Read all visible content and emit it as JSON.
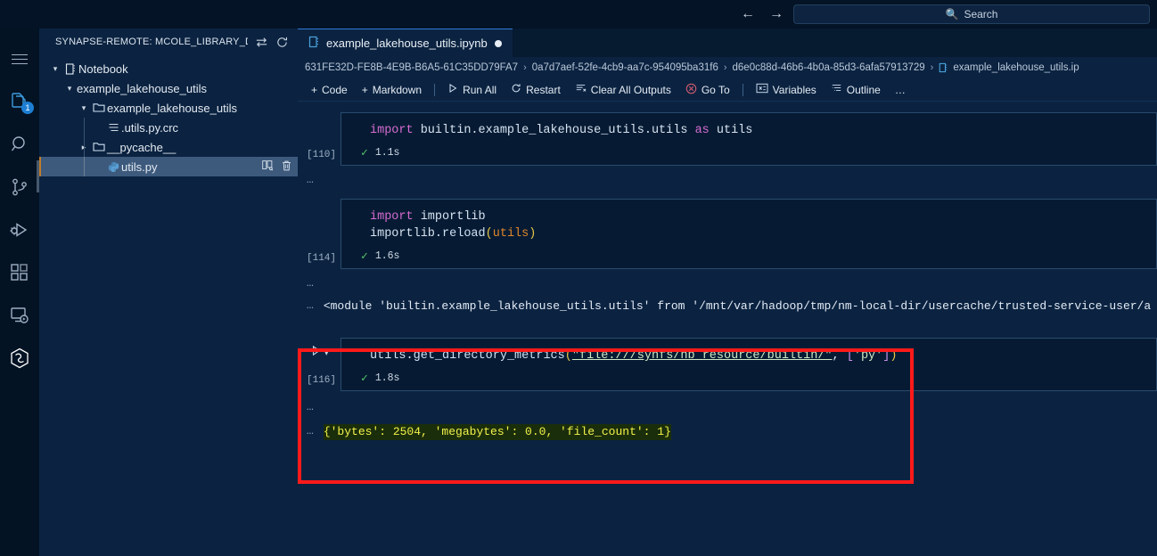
{
  "titlebar": {
    "back_icon": "arrow-left-icon",
    "forward_icon": "arrow-right-icon",
    "search_placeholder": "Search",
    "search_value": "",
    "search_icon": "search-icon"
  },
  "activitybar": {
    "items": [
      {
        "name": "menu-icon",
        "label": "Menu",
        "badge": ""
      },
      {
        "name": "explorer-icon",
        "label": "Explorer",
        "badge": "1"
      },
      {
        "name": "search-icon",
        "label": "Search",
        "badge": ""
      },
      {
        "name": "source-control-icon",
        "label": "Source Control",
        "badge": ""
      },
      {
        "name": "run-and-debug-icon",
        "label": "Run and Debug",
        "badge": ""
      },
      {
        "name": "extensions-icon",
        "label": "Extensions",
        "badge": ""
      },
      {
        "name": "remote-explorer-icon",
        "label": "Remote Explorer",
        "badge": ""
      },
      {
        "name": "synapse-icon",
        "label": "Azure Synapse",
        "badge": ""
      }
    ]
  },
  "sidebar": {
    "title": "SYNAPSE-REMOTE: MCOLE_LIBRARY_DE...",
    "switch_icon": "switch-arrows-icon",
    "refresh_icon": "refresh-icon",
    "tree": [
      {
        "label": "Notebook",
        "indent": 0,
        "twisty": "down",
        "icon": "notebook-icon",
        "selected": false
      },
      {
        "label": "example_lakehouse_utils",
        "indent": 1,
        "twisty": "down",
        "icon": "none",
        "selected": false
      },
      {
        "label": "example_lakehouse_utils",
        "indent": 2,
        "twisty": "down",
        "icon": "folder-icon",
        "selected": false
      },
      {
        "label": ".utils.py.crc",
        "indent": 3,
        "twisty": "none",
        "icon": "file-lines-icon",
        "selected": false
      },
      {
        "label": "__pycache__",
        "indent": 3,
        "twisty": "right",
        "icon": "folder-icon",
        "selected": false
      },
      {
        "label": "utils.py",
        "indent": 3,
        "twisty": "none",
        "icon": "python-icon",
        "selected": true,
        "actions": [
          "open-to-side-icon",
          "trash-icon"
        ]
      }
    ]
  },
  "editor": {
    "tab": {
      "label": "example_lakehouse_utils.ipynb",
      "icon": "notebook-icon",
      "dirty": true
    },
    "breadcrumbs": [
      {
        "label": "631FE32D-FE8B-4E9B-B6A5-61C35DD79FA7",
        "icon": "none"
      },
      {
        "label": "0a7d7aef-52fe-4cb9-aa7c-954095ba31f6",
        "icon": "none"
      },
      {
        "label": "d6e0c88d-46b6-4b0a-85d3-6afa57913729",
        "icon": "none"
      },
      {
        "label": "example_lakehouse_utils.ip",
        "icon": "notebook-icon"
      }
    ],
    "breadcrumb_separator": "›",
    "toolbar": {
      "code_label": "Code",
      "markdown_label": "Markdown",
      "run_all_label": "Run All",
      "restart_label": "Restart",
      "clear_outputs_label": "Clear All Outputs",
      "go_to_label": "Go To",
      "variables_label": "Variables",
      "outline_label": "Outline",
      "more_label": "…"
    }
  },
  "notebook": {
    "cells": [
      {
        "exec_count": "[110]",
        "code_tokens": [
          {
            "t": "import",
            "c": "kw"
          },
          {
            "t": " builtin.example_lakehouse_utils.utils ",
            "c": "id"
          },
          {
            "t": "as",
            "c": "kw"
          },
          {
            "t": " utils",
            "c": "id"
          }
        ],
        "status_icon": "check-icon",
        "duration": "1.1s",
        "outputs": []
      },
      {
        "exec_count": "[114]",
        "code_tokens": [
          {
            "t": "import",
            "c": "kw"
          },
          {
            "t": " importlib\n",
            "c": "id"
          },
          {
            "t": "importlib",
            "c": "id"
          },
          {
            "t": ".",
            "c": "id"
          },
          {
            "t": "reload",
            "c": "fn"
          },
          {
            "t": "(",
            "c": "punct"
          },
          {
            "t": "utils",
            "c": "var"
          },
          {
            "t": ")",
            "c": "punct"
          }
        ],
        "status_icon": "check-icon",
        "duration": "1.6s",
        "outputs": [
          {
            "text": "<module 'builtin.example_lakehouse_utils.utils' from '/mnt/var/hadoop/tmp/nm-local-dir/usercache/trusted-service-user/a",
            "highlight": false
          }
        ]
      },
      {
        "exec_count": "[116]",
        "run_icon": "play-icon",
        "chevron_icon": "chevron-down-icon",
        "code_tokens": [
          {
            "t": "utils",
            "c": "id"
          },
          {
            "t": ".",
            "c": "id"
          },
          {
            "t": "get_directory_metrics",
            "c": "fn"
          },
          {
            "t": "(",
            "c": "punct"
          },
          {
            "t": "\"file:///synfs/nb_resource/builtin/\"",
            "c": "str"
          },
          {
            "t": ", ",
            "c": "id"
          },
          {
            "t": "[",
            "c": "brk"
          },
          {
            "t": "'py'",
            "c": "str2"
          },
          {
            "t": "]",
            "c": "brk"
          },
          {
            "t": ")",
            "c": "punct"
          }
        ],
        "status_icon": "check-icon",
        "duration": "1.8s",
        "outputs": [
          {
            "text": "{'bytes': 2504, 'megabytes': 0.0, 'file_count': 1}",
            "highlight": true
          }
        ],
        "annotated": true
      }
    ],
    "collapse_ellipsis": "…"
  },
  "colors": {
    "accent": "#2f7ad6",
    "annotation": "#ff1a1a",
    "success": "#55c46a",
    "output_highlight_bg": "#1b2e0b",
    "output_highlight_fg": "#f2f24a",
    "selection_bg": "#3d5a7d",
    "badge_bg": "#1d7fd4"
  }
}
